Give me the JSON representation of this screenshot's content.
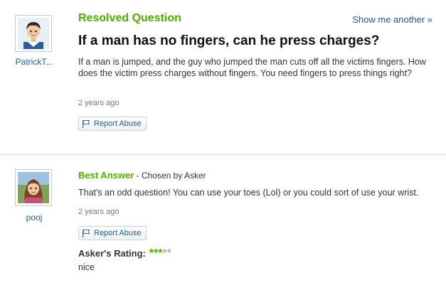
{
  "question": {
    "status_label": "Resolved Question",
    "show_another": "Show me another »",
    "title": "If a man has no fingers, can he press charges?",
    "body": "If a man is jumped, and the guy who jumped the man cuts off all the victims fingers. How does the victim press charges without fingers. You need fingers to press things right?",
    "timestamp": "2 years ago",
    "report_label": "Report Abuse",
    "asker_name": "PatrickT..."
  },
  "best_answer": {
    "label": "Best Answer",
    "chosen_by": " - Chosen by Asker",
    "body": "That's an odd question! You can use your toes (Lol) or you could sort of use your wrist.",
    "timestamp": "2 years ago",
    "report_label": "Report Abuse",
    "answerer_name": "pooj",
    "rating_label": "Asker's Rating:",
    "rating_value": 3,
    "rating_max": 5,
    "rating_comment": "nice"
  },
  "colors": {
    "accent_green": "#4fae00",
    "link_blue": "#1a5dab",
    "star_off": "#b5b5b5"
  },
  "icons": {
    "report": "flag-icon",
    "asker_avatar": "male-avatar-icon",
    "answerer_avatar": "female-avatar-icon"
  }
}
